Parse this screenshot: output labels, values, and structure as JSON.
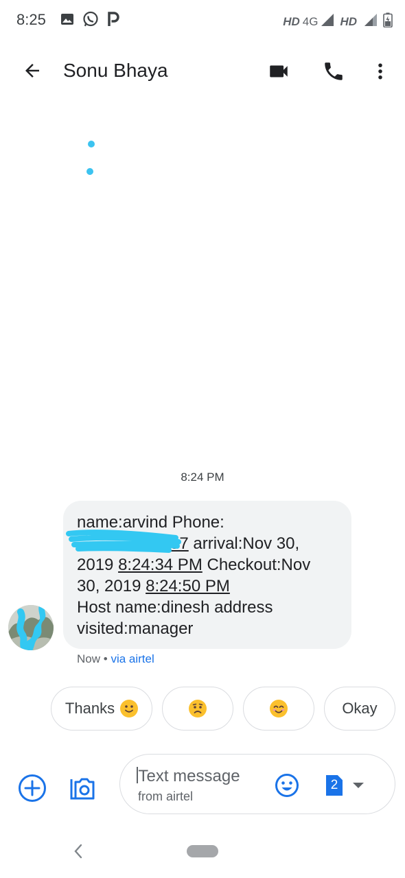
{
  "status_bar": {
    "time": "8:25",
    "left_icons": [
      "image-icon",
      "whatsapp-icon",
      "p-app-icon"
    ],
    "network_1_hd": "HD",
    "network_1_type": "4G",
    "network_2_hd": "HD",
    "icons": [
      "signal-icon",
      "signal-icon",
      "battery-icon"
    ]
  },
  "app_bar": {
    "contact_name": "Sonu Bhaya",
    "icons": [
      "back-arrow-icon",
      "video-call-icon",
      "phone-icon",
      "more-vert-icon"
    ]
  },
  "conversation": {
    "timestamp": "8:24 PM",
    "message": {
      "line1": "name:arvind Phone:",
      "phone_visible_tail": "79797",
      "line2_rest": " arrival:Nov 30,",
      "line3_pre": "2019 ",
      "time_arrival": "8:24:34 PM",
      "line3_post": " Checkout:Nov",
      "line4_pre": "30, 2019 ",
      "time_checkout": "8:24:50 PM",
      "line5": "Host name:dinesh address",
      "line6": "visited:manager"
    },
    "meta_time": "Now",
    "meta_separator": "•",
    "meta_via": "via airtel"
  },
  "smart_replies": [
    {
      "label": "Thanks",
      "emoji": "slightly-smiling-face-icon"
    },
    {
      "label": "",
      "emoji": "worried-face-icon"
    },
    {
      "label": "",
      "emoji": "smiling-face-icon"
    },
    {
      "label": "Okay",
      "emoji": ""
    }
  ],
  "compose": {
    "placeholder": "Text message",
    "subtext": "from airtel",
    "sim_number": "2",
    "icons": [
      "add-circle-icon",
      "camera-icon",
      "emoji-icon",
      "sim-icon",
      "dropdown-arrow-icon"
    ]
  },
  "colors": {
    "accent": "#1a73e8",
    "bubble_bg": "#f1f3f4",
    "loading_dots": "#3cc3f0",
    "redaction": "#33c8f2",
    "emoji_yellow": "#fbc02d"
  }
}
